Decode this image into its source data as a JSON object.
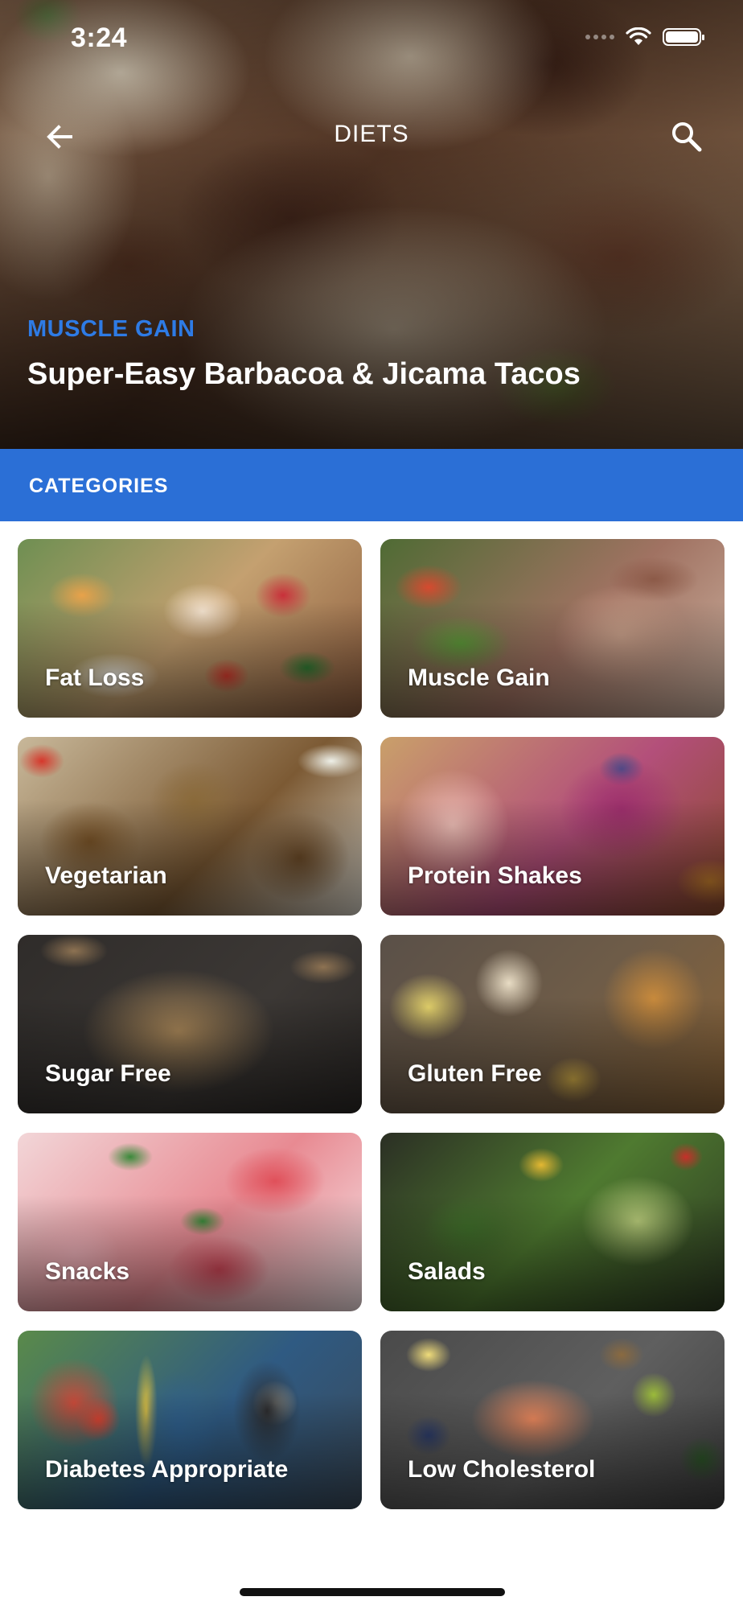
{
  "status_bar": {
    "time": "3:24"
  },
  "nav": {
    "title": "DIETS",
    "back_icon": "arrow-left-icon",
    "search_icon": "search-icon"
  },
  "featured": {
    "tag": "MUSCLE GAIN",
    "title": "Super-Easy Barbacoa & Jicama Tacos",
    "tag_color": "#2e7be5"
  },
  "categories": {
    "header": "CATEGORIES",
    "header_color": "#2b6fd6",
    "items": [
      {
        "label": "Fat Loss"
      },
      {
        "label": "Muscle Gain"
      },
      {
        "label": "Vegetarian"
      },
      {
        "label": "Protein Shakes"
      },
      {
        "label": "Sugar Free"
      },
      {
        "label": "Gluten Free"
      },
      {
        "label": "Snacks"
      },
      {
        "label": "Salads"
      },
      {
        "label": "Diabetes Appropriate"
      },
      {
        "label": "Low Cholesterol"
      }
    ]
  }
}
